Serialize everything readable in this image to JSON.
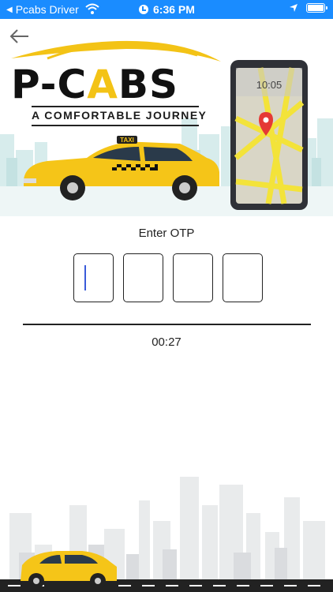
{
  "status_bar": {
    "back_app_label": "Pcabs Driver",
    "time": "6:36 PM",
    "bar_color": "#1a8cff"
  },
  "header": {
    "back_icon": "arrow-left-icon",
    "logo_prefix": "P-C",
    "logo_accent": "A",
    "logo_suffix": "BS",
    "tagline": "A COMFORTABLE JOURNEY",
    "taxi_sign": "TAXI",
    "phone_clock": "10:05",
    "brand_color": "#f3c316"
  },
  "otp": {
    "label": "Enter OTP",
    "digits": [
      "",
      "",
      "",
      ""
    ],
    "timer": "00:27"
  }
}
